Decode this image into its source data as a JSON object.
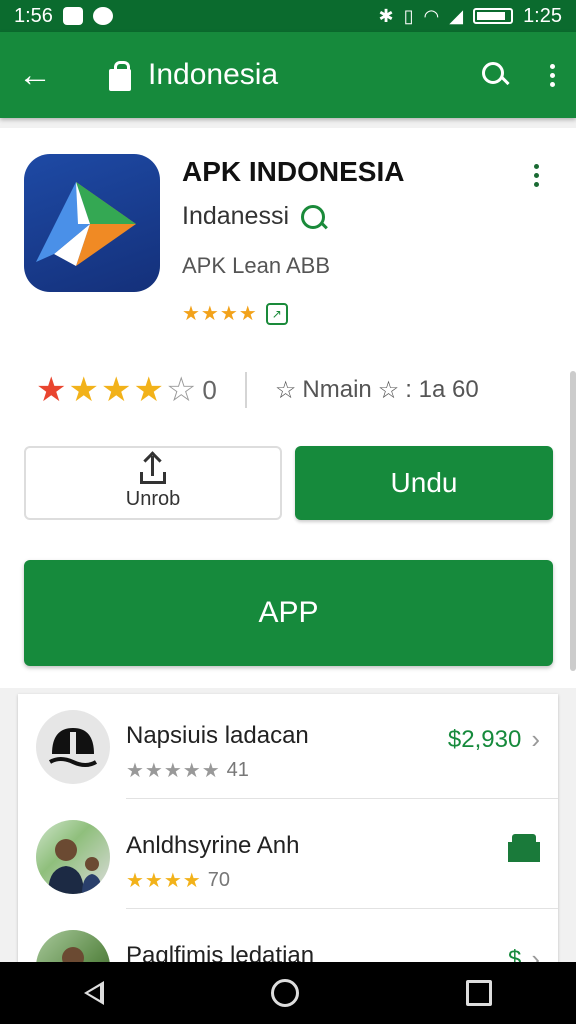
{
  "status_bar": {
    "time_left": "1:56",
    "time_right": "1:25"
  },
  "app_bar": {
    "title": "Indonesia"
  },
  "app": {
    "name": "APK INDONESIA",
    "developer": "Indanessi",
    "category": "APK Lean ABB",
    "small_rating_stars": "★★★★"
  },
  "stats": {
    "rating_count": "0",
    "right_label": "Nmain",
    "right_value": ": 1a 60"
  },
  "buttons": {
    "secondary_label": "Unrob",
    "install_label": "Undu",
    "app_label": "APP"
  },
  "list": [
    {
      "name": "Napsiuis ladacan",
      "stars": "★★★★★",
      "count": "41",
      "price": "$2,930",
      "rating_fraction": 0.8
    },
    {
      "name": "Anldhsyrine Anh",
      "stars": "★★★★",
      "count": "70",
      "price": "",
      "rating_fraction": 0.75
    },
    {
      "name": "Paglfimis ledatian",
      "stars": "",
      "count": "",
      "price": "$",
      "rating_fraction": 0
    }
  ],
  "colors": {
    "primary": "#168a3c",
    "status_bar": "#0b6b2e",
    "star_yellow": "#f2b21a",
    "star_red": "#e9452f"
  }
}
